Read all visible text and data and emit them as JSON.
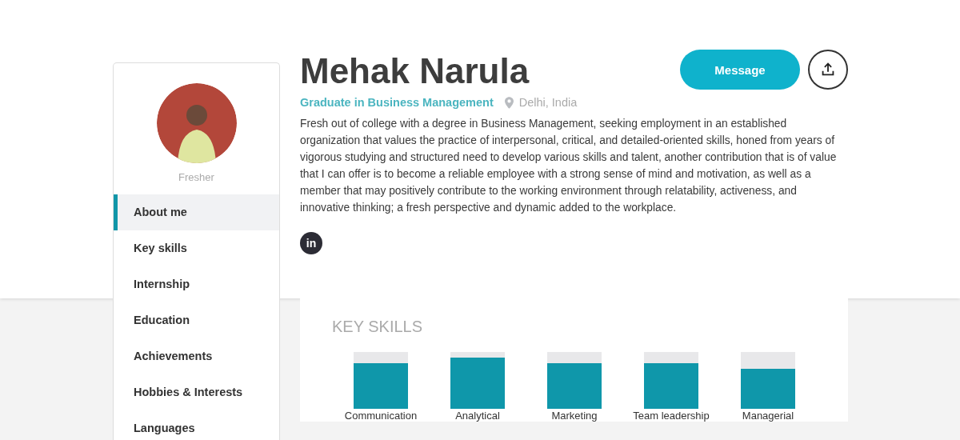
{
  "profile": {
    "name": "Mehak Narula",
    "status": "Fresher",
    "headline": "Graduate in Business Management",
    "location": "Delhi, India",
    "about": "Fresh out of college with a degree in Business Management, seeking employment in an established organization that values the practice of interpersonal, critical, and detailed-oriented skills, honed from years of vigorous studying and structured need to develop various skills and talent, another contribution that is of value that I can offer is to become a reliable employee with a strong sense of mind and motivation, as well as a member that may positively contribute to the working environment through relatability, activeness, and innovative thinking; a fresh perspective and dynamic added to the workplace.",
    "social_links": [
      {
        "kind": "linkedin",
        "label": "in"
      }
    ]
  },
  "actions": {
    "message_button": "Message"
  },
  "sidebar": {
    "items": [
      {
        "label": "About me",
        "selected": true
      },
      {
        "label": "Key skills",
        "selected": false
      },
      {
        "label": "Internship",
        "selected": false
      },
      {
        "label": "Education",
        "selected": false
      },
      {
        "label": "Achievements",
        "selected": false
      },
      {
        "label": "Hobbies & Interests",
        "selected": false
      },
      {
        "label": "Languages",
        "selected": false
      }
    ]
  },
  "key_skills": {
    "title": "KEY SKILLS",
    "skills": [
      {
        "name": "Communication",
        "level": 0.8
      },
      {
        "name": "Analytical",
        "level": 0.9
      },
      {
        "name": "Marketing",
        "level": 0.8
      },
      {
        "name": "Team leadership",
        "level": 0.8
      },
      {
        "name": "Managerial",
        "level": 0.7
      }
    ]
  }
}
